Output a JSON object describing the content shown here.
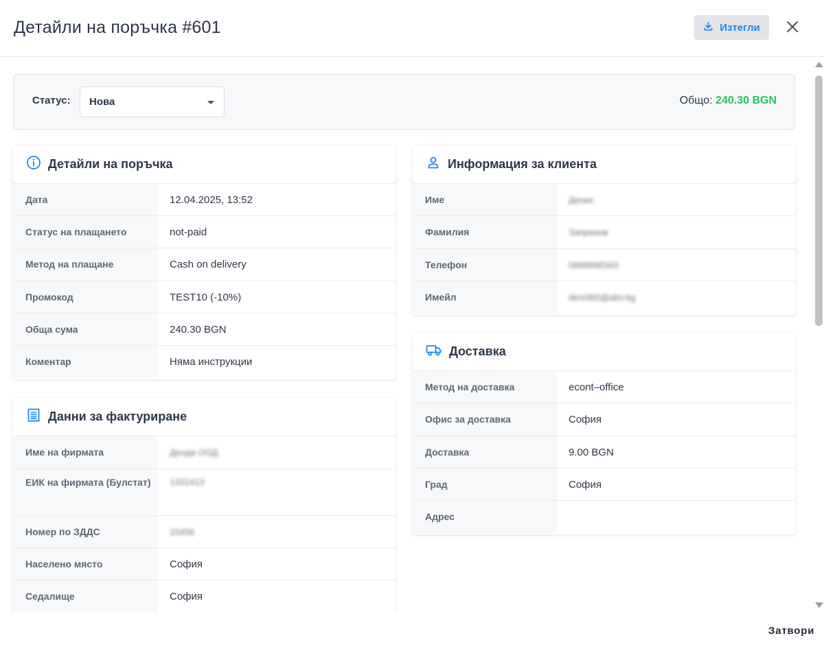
{
  "header": {
    "title": "Детайли на поръчка #601",
    "download_label": "Изтегли"
  },
  "status_bar": {
    "label": "Статус:",
    "selected": "Нова",
    "total_label": "Общо:",
    "total_value": "240.30 BGN"
  },
  "order_details": {
    "title": "Детайли на поръчка",
    "rows": [
      {
        "label": "Дата",
        "value": "12.04.2025, 13:52"
      },
      {
        "label": "Статус на плащането",
        "value": "not-paid"
      },
      {
        "label": "Метод на плащане",
        "value": "Cash on delivery"
      },
      {
        "label": "Промокод",
        "value": "TEST10 (-10%)"
      },
      {
        "label": "Обща сума",
        "value": "240.30 BGN"
      },
      {
        "label": "Коментар",
        "value": "Няма инструкции"
      }
    ]
  },
  "billing": {
    "title": "Данни за фактуриране",
    "rows": [
      {
        "label": "Име на фирмата",
        "value": "Денди ООД"
      },
      {
        "label": "ЕИК на фирмата (Булстат)",
        "value": "1331413"
      },
      {
        "label": "Номер по ЗДДС",
        "value": "15456"
      },
      {
        "label": "Населено място",
        "value": "София"
      },
      {
        "label": "Седалище",
        "value": "София"
      }
    ]
  },
  "client": {
    "title": "Информация за клиента",
    "rows": [
      {
        "label": "Име",
        "value": "Денис"
      },
      {
        "label": "Фамилия",
        "value": "Запрянов"
      },
      {
        "label": "Телефон",
        "value": "0898998343"
      },
      {
        "label": "Имейл",
        "value": "deni365@abv.bg"
      }
    ]
  },
  "delivery": {
    "title": "Доставка",
    "rows": [
      {
        "label": "Метод на доставка",
        "value": "econt–office"
      },
      {
        "label": "Офис за доставка",
        "value": "София"
      },
      {
        "label": "Доставка",
        "value": "9.00 BGN"
      },
      {
        "label": "Град",
        "value": "София"
      },
      {
        "label": "Адрес",
        "value": ""
      }
    ]
  },
  "footer": {
    "close_label": "Затвори"
  },
  "colors": {
    "accent": "#1e88e5",
    "total_green": "#22c55e",
    "text": "#2d3748",
    "label_bg": "#f7f8fa"
  },
  "icons": {
    "download": "download-icon",
    "close": "close-icon",
    "order": "info-circle-icon",
    "billing": "receipt-icon",
    "client": "user-icon",
    "delivery": "truck-icon"
  }
}
